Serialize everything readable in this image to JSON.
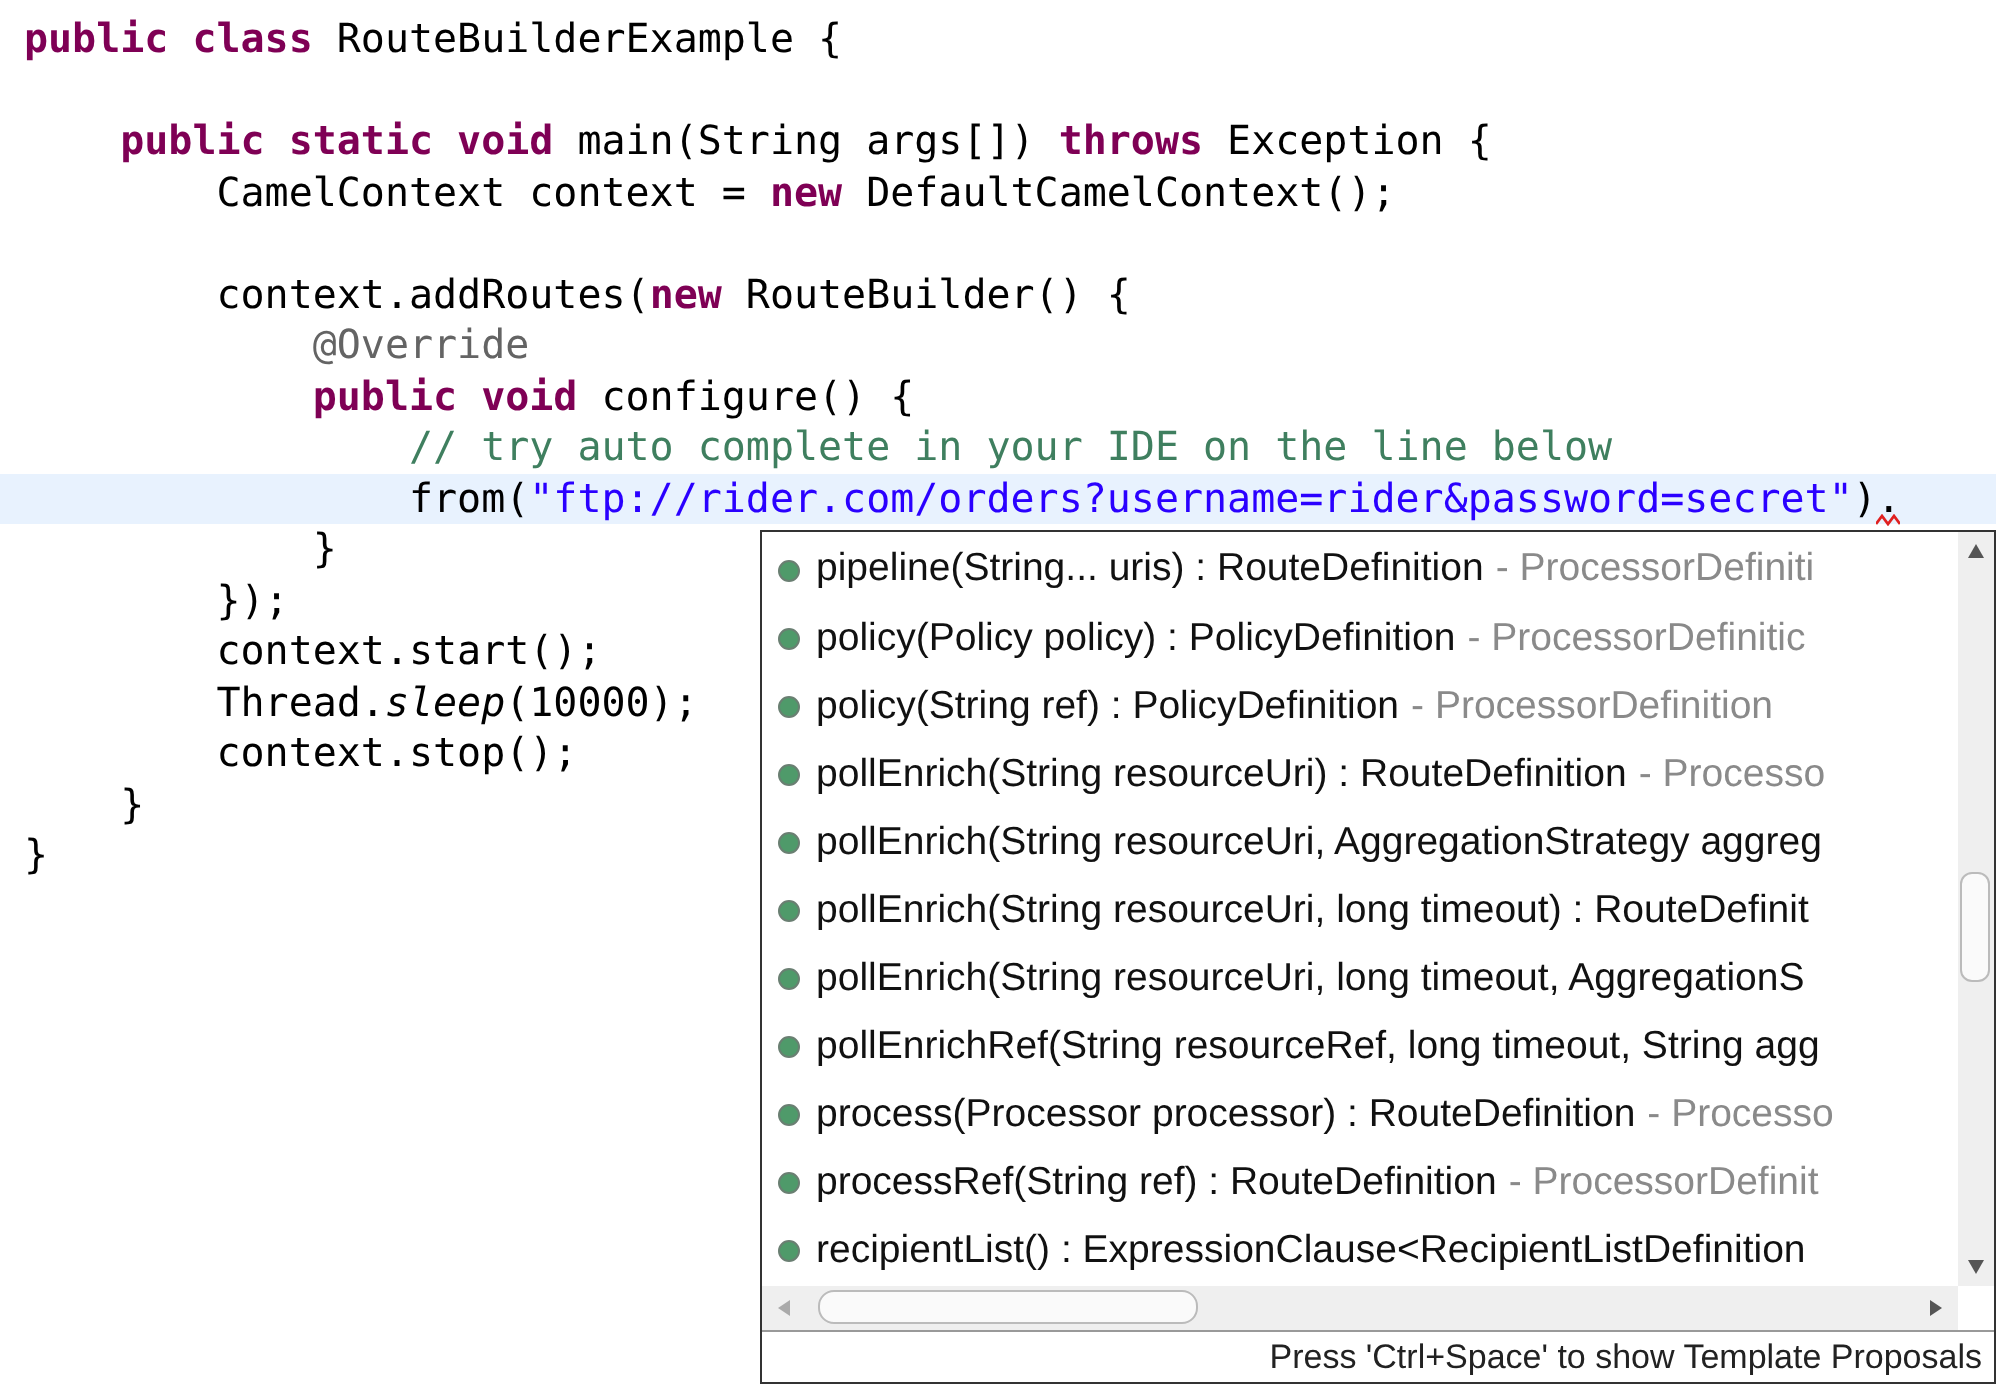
{
  "editor": {
    "lines": [
      {
        "kind": "code",
        "tokens": [
          {
            "kind": "kw",
            "t": "public class"
          },
          {
            "kind": "plain",
            "t": " RouteBuilderExample {"
          }
        ]
      },
      {
        "kind": "blank"
      },
      {
        "kind": "code",
        "tokens": [
          {
            "kind": "kw",
            "t": "    public static void"
          },
          {
            "kind": "plain",
            "t": " main(String args[]) "
          },
          {
            "kind": "kw",
            "t": "throws"
          },
          {
            "kind": "plain",
            "t": " Exception {"
          }
        ]
      },
      {
        "kind": "code",
        "tokens": [
          {
            "kind": "plain",
            "t": "        CamelContext context = "
          },
          {
            "kind": "kw",
            "t": "new"
          },
          {
            "kind": "plain",
            "t": " DefaultCamelContext();"
          }
        ]
      },
      {
        "kind": "blank"
      },
      {
        "kind": "code",
        "tokens": [
          {
            "kind": "plain",
            "t": "        context.addRoutes("
          },
          {
            "kind": "kw",
            "t": "new"
          },
          {
            "kind": "plain",
            "t": " RouteBuilder() {"
          }
        ]
      },
      {
        "kind": "code",
        "tokens": [
          {
            "kind": "annotation",
            "t": "            @Override"
          }
        ]
      },
      {
        "kind": "code",
        "tokens": [
          {
            "kind": "kw",
            "t": "            public void"
          },
          {
            "kind": "plain",
            "t": " configure() {"
          }
        ]
      },
      {
        "kind": "code",
        "tokens": [
          {
            "kind": "comment",
            "t": "                // try auto complete in your IDE on the line below"
          }
        ]
      },
      {
        "kind": "code",
        "current": true,
        "error": true,
        "tokens": [
          {
            "kind": "plain",
            "t": "                from("
          },
          {
            "kind": "string",
            "t": "\"ftp://rider.com/orders?username=rider&password=secret\""
          },
          {
            "kind": "plain",
            "t": ")."
          }
        ]
      },
      {
        "kind": "code",
        "tokens": [
          {
            "kind": "plain",
            "t": "            }"
          }
        ]
      },
      {
        "kind": "code",
        "tokens": [
          {
            "kind": "plain",
            "t": "        });"
          }
        ]
      },
      {
        "kind": "code",
        "tokens": [
          {
            "kind": "plain",
            "t": "        context.start();"
          }
        ]
      },
      {
        "kind": "code",
        "tokens": [
          {
            "kind": "plain",
            "t": "        Thread."
          },
          {
            "kind": "static",
            "t": "sleep"
          },
          {
            "kind": "plain",
            "t": "(10000);"
          }
        ]
      },
      {
        "kind": "code",
        "tokens": [
          {
            "kind": "plain",
            "t": "        context.stop();"
          }
        ]
      },
      {
        "kind": "code",
        "tokens": [
          {
            "kind": "plain",
            "t": "    }"
          }
        ]
      },
      {
        "kind": "code",
        "tokens": [
          {
            "kind": "plain",
            "t": "}"
          }
        ]
      }
    ]
  },
  "completion_popup": {
    "proposals": [
      {
        "signature": "pipeline(String... uris) : RouteDefinition",
        "declaring": "- ProcessorDefiniti"
      },
      {
        "signature": "policy(Policy policy) : PolicyDefinition",
        "declaring": "- ProcessorDefinitic"
      },
      {
        "signature": "policy(String ref) : PolicyDefinition",
        "declaring": "- ProcessorDefinition"
      },
      {
        "signature": "pollEnrich(String resourceUri) : RouteDefinition",
        "declaring": "- Processo"
      },
      {
        "signature": "pollEnrich(String resourceUri, AggregationStrategy aggreg"
      },
      {
        "signature": "pollEnrich(String resourceUri, long timeout) : RouteDefinit"
      },
      {
        "signature": "pollEnrich(String resourceUri, long timeout, AggregationS"
      },
      {
        "signature": "pollEnrichRef(String resourceRef, long timeout, String agg"
      },
      {
        "signature": "process(Processor processor) : RouteDefinition",
        "declaring": "- Processo"
      },
      {
        "signature": "processRef(String ref) : RouteDefinition",
        "declaring": "- ProcessorDefinit"
      },
      {
        "signature": "recipientList() : ExpressionClause<RecipientListDefinition"
      }
    ],
    "status": "Press 'Ctrl+Space' to show Template Proposals"
  }
}
